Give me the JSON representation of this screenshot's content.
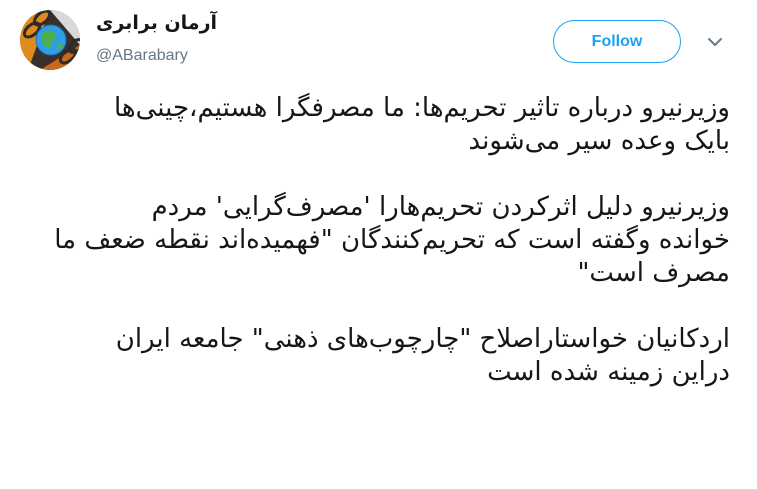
{
  "user": {
    "display_name": "آرمان برابری",
    "handle": "@ABarabary"
  },
  "actions": {
    "follow_label": "Follow"
  },
  "tweet": {
    "paragraphs": [
      "وزیرنیرو درباره تاثیر تحریم‌ها: ما مصرفگرا هستیم،چینی‌ها\nبایک وعده سیر می‌شوند",
      "وزیرنیرو دلیل اثرکردن تحریم‌هارا 'مصرف‌گرایی' مردم\nخوانده وگفته است که تحریم‌کنندگان \"فهمیده‌اند نقطه ضعف ما\nمصرف است\"",
      "اردکانیان خواستاراصلاح \"چارچوب‌های ذهنی\" جامعه ایران\nدراین زمینه شده است"
    ]
  },
  "colors": {
    "accent": "#1da1f2",
    "text": "#14171a",
    "muted": "#657786"
  },
  "icons": {
    "avatar": "avatar-globe-chain",
    "caret": "chevron-down-icon"
  }
}
